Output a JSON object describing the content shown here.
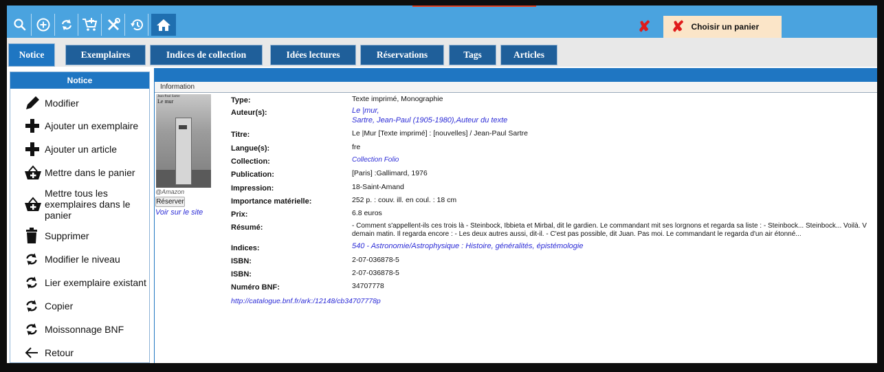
{
  "toolbar": {
    "icons": [
      "search-icon",
      "add-circle-icon",
      "refresh-icon",
      "cart-icon",
      "tools-icon",
      "history-icon",
      "home-icon"
    ]
  },
  "cart": {
    "label": "Choisir un panier",
    "icon": "red-x-icon"
  },
  "tabs": [
    {
      "label": "Notice",
      "active": true
    },
    {
      "label": "Exemplaires"
    },
    {
      "label": "Indices de collection"
    },
    {
      "label": "Idées lectures"
    },
    {
      "label": "Réservations"
    },
    {
      "label": "Tags"
    },
    {
      "label": "Articles"
    }
  ],
  "sidebar": {
    "title": "Notice",
    "items": [
      {
        "label": "Modifier",
        "icon": "pencil-icon"
      },
      {
        "label": "Ajouter un exemplaire",
        "icon": "plus-icon"
      },
      {
        "label": "Ajouter un article",
        "icon": "plus-icon"
      },
      {
        "label": "Mettre dans le panier",
        "icon": "basket-icon"
      },
      {
        "label": "Mettre tous les exemplaires dans le panier",
        "icon": "basket-icon"
      },
      {
        "label": "Supprimer",
        "icon": "trash-icon"
      },
      {
        "label": "Modifier le niveau",
        "icon": "refresh-icon"
      },
      {
        "label": "Lier exemplaire existant",
        "icon": "refresh-icon"
      },
      {
        "label": "Copier",
        "icon": "refresh-icon"
      },
      {
        "label": "Moissonnage BNF",
        "icon": "refresh-icon"
      },
      {
        "label": "Retour",
        "icon": "arrow-left-icon"
      }
    ]
  },
  "info": {
    "tab_label": "Information",
    "cover_author": "Jean-Paul Sartre",
    "cover_title": "Le mur",
    "cover_credit": "@Amazon",
    "reserve_label": "Réserver",
    "site_link": "Voir sur le site",
    "fields": {
      "type_label": "Type:",
      "type_value": "Texte imprimé, Monographie",
      "auteur_label": "Auteur(s):",
      "auteur_value1": "Le |mur,",
      "auteur_value2": "Sartre, Jean-Paul (1905-1980),Auteur du texte",
      "titre_label": "Titre:",
      "titre_value": "Le |Mur [Texte imprimé] : [nouvelles] / Jean-Paul Sartre",
      "langue_label": "Langue(s):",
      "langue_value": "fre",
      "collection_label": "Collection:",
      "collection_value": "Collection Folio",
      "publication_label": "Publication:",
      "publication_value": "[Paris] :Gallimard, 1976",
      "impression_label": "Impression:",
      "impression_value": "18-Saint-Amand",
      "importance_label": "Importance matérielle:",
      "importance_value": "252 p. : couv. ill. en coul. : 18 cm",
      "prix_label": "Prix:",
      "prix_value": "6.8 euros",
      "resume_label": "Résumé:",
      "resume_value1": "- Comment s'appellent-ils ces trois là - Steinbock, Ibbieta et Mirbal, dit le gardien. Le commandant mit ses lorgnons et regarda sa liste : - Steinbock... Steinbock... Voilà. V",
      "resume_value2": "demain matin. Il regarda encore : - Les deux autres aussi, dit-il. - C'est pas possible, dit Juan. Pas moi. Le commandant le regarda d'un air étonné...",
      "indices_label": "Indices:",
      "indices_value": "540 - Astronomie/Astrophysique : Histoire, généralités, épistémologie",
      "isbn1_label": "ISBN:",
      "isbn1_value": "2-07-036878-5",
      "isbn2_label": "ISBN:",
      "isbn2_value": "2-07-036878-5",
      "bnf_label": "Numéro BNF:",
      "bnf_value": "34707778",
      "bnf_link": "http://catalogue.bnf.fr/ark:/12148/cb34707778p"
    }
  },
  "colors": {
    "topbar": "#4aa3df",
    "tab": "#1f5f9a",
    "active_tab": "#1f76c2",
    "link": "#2b2bd6",
    "cart_bg": "#fbe5c8",
    "x_red": "#e01b1b"
  }
}
